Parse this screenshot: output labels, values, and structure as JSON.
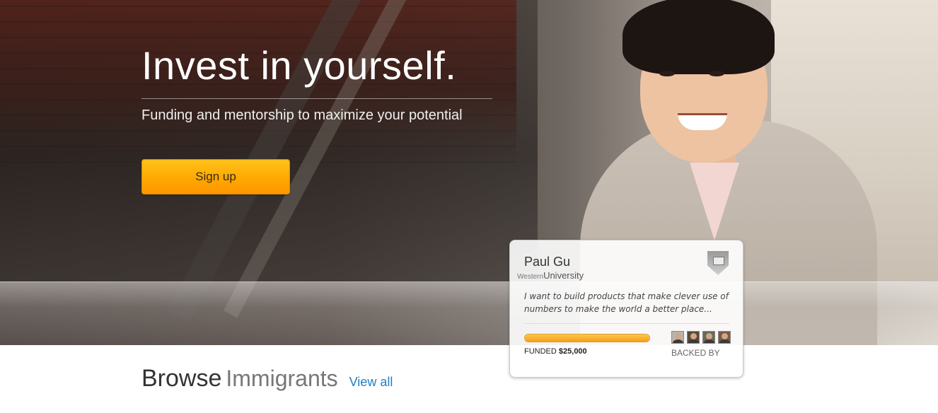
{
  "hero": {
    "title": "Invest in yourself.",
    "subtitle": "Funding and mentorship to maximize your potential",
    "signup_label": "Sign up"
  },
  "profile_card": {
    "name": "Paul Gu",
    "university_prefix": "Western",
    "university": "University",
    "quote": "I want to build products that make clever use of numbers to make the world a better place...",
    "funded_label": "FUNDED",
    "funded_amount": "$25,000",
    "funded_progress_fraction": 1.0,
    "backed_by_label": "BACKED BY",
    "backers_count_shown": 4,
    "crest_icon": "university-crest-icon"
  },
  "browse": {
    "title_part1": "Browse",
    "title_part2": "Immigrants",
    "view_all": "View all"
  },
  "colors": {
    "accent_button": "#ffa600",
    "link": "#1e7fc2",
    "progress": "#f2a019"
  }
}
